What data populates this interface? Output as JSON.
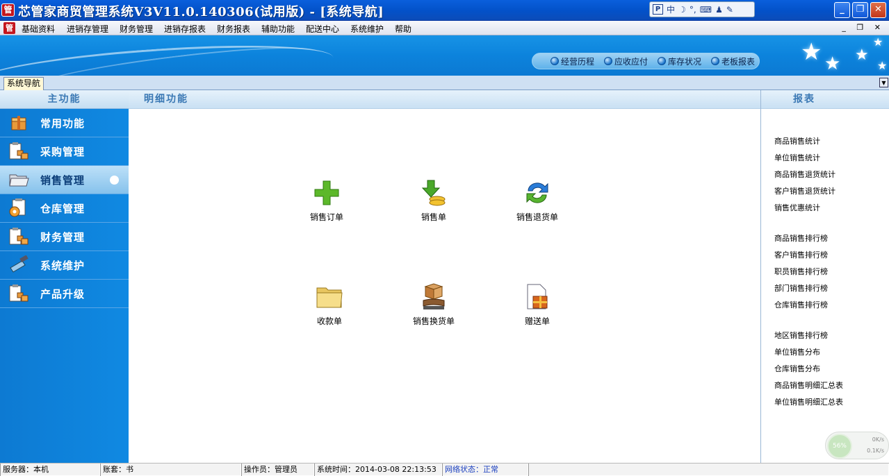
{
  "window": {
    "logo_char": "管",
    "title": "芯管家商贸管理系统V3V11.0.140306(试用版) - [系统导航]"
  },
  "ime": {
    "logo": "P",
    "mode": "中",
    "moon": "☽",
    "punct": "°,",
    "keyboard": "⌨",
    "user": "♟",
    "tool": "✎"
  },
  "window_buttons": {
    "minimize": "_",
    "restore": "❐",
    "close": "✕"
  },
  "menu": {
    "logo_char": "管",
    "items": [
      "基础资料",
      "进销存管理",
      "财务管理",
      "进销存报表",
      "财务报表",
      "辅助功能",
      "配送中心",
      "系统维护",
      "帮助"
    ],
    "right_controls": "_ ❐ ✕"
  },
  "quick_links": [
    "经营历程",
    "应收应付",
    "库存状况",
    "老板报表"
  ],
  "tab": {
    "label": "系统导航",
    "dropdown": "▼"
  },
  "sidebar": {
    "title": "主功能",
    "items": [
      {
        "label": "常用功能",
        "icon": "box-icon"
      },
      {
        "label": "采购管理",
        "icon": "clipboard-boxes-icon"
      },
      {
        "label": "销售管理",
        "icon": "folder-open-icon",
        "active": true
      },
      {
        "label": "仓库管理",
        "icon": "clipboard-gear-icon"
      },
      {
        "label": "财务管理",
        "icon": "clipboard-boxes-icon"
      },
      {
        "label": "系统维护",
        "icon": "hammer-icon"
      },
      {
        "label": "产品升级",
        "icon": "clipboard-boxes-icon"
      }
    ]
  },
  "detail": {
    "title": "明细功能",
    "functions": [
      {
        "label": "销售订单",
        "icon": "plus-icon"
      },
      {
        "label": "销售单",
        "icon": "download-coins-icon"
      },
      {
        "label": "销售退货单",
        "icon": "return-arrows-icon"
      },
      {
        "label": "收款单",
        "icon": "folder-icon"
      },
      {
        "label": "销售换货单",
        "icon": "exchange-box-icon"
      },
      {
        "label": "赠送单",
        "icon": "gift-document-icon"
      }
    ]
  },
  "reports": {
    "title": "报表",
    "items": [
      "商品销售统计",
      "单位销售统计",
      "商品销售退货统计",
      "客户销售退货统计",
      "销售优惠统计",
      "商品销售排行榜",
      "客户销售排行榜",
      "职员销售排行榜",
      "部门销售排行榜",
      "仓库销售排行榜",
      "地区销售排行榜",
      "单位销售分布",
      "仓库销售分布",
      "商品销售明细汇总表",
      "单位销售明细汇总表"
    ]
  },
  "netspeed": {
    "percent": "56%",
    "up": "0K/s",
    "down": "0.1K/s"
  },
  "status": {
    "server": "服务器：本机",
    "account": "账套：书",
    "operator": "操作员：管理员",
    "time": "系统时间：2014-03-08 22:13:53",
    "network": "网络状态：正常"
  },
  "colors": {
    "accent": "#0d7ad2",
    "title_bar": "#0351c8",
    "header_text": "#3a78b4",
    "network_status": "#1a3fbf"
  }
}
